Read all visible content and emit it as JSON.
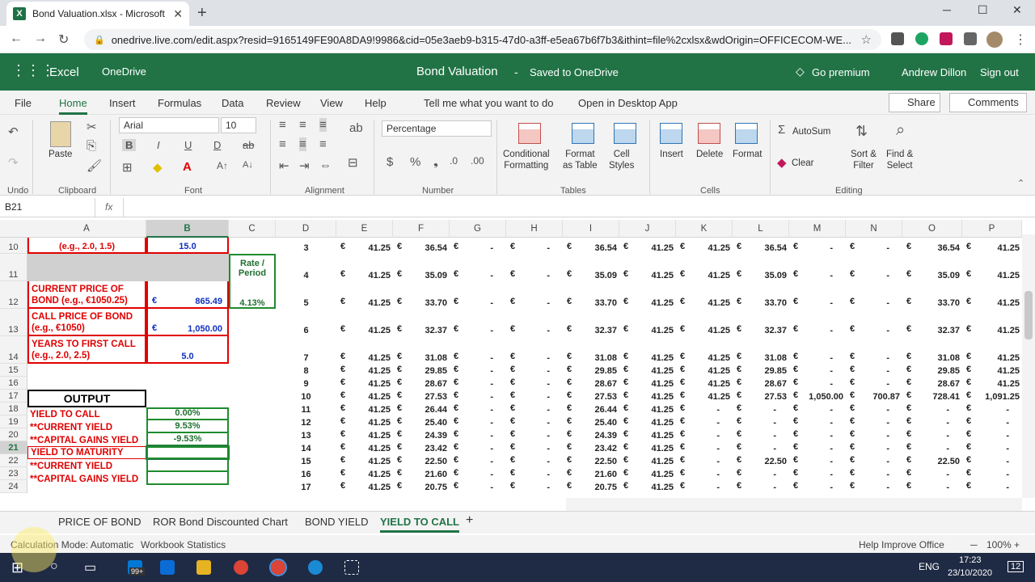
{
  "browser": {
    "tab_title": "Bond Valuation.xlsx - Microsoft E",
    "url": "onedrive.live.com/edit.aspx?resid=9165149FE90A8DA9!9986&cid=05e3aeb9-b315-47d0-a3ff-e5ea67b6f7b3&ithint=file%2cxlsx&wdOrigin=OFFICECOM-WE..."
  },
  "app": {
    "name": "Excel",
    "location": "OneDrive",
    "doc_title": "Bond Valuation",
    "dash": "-",
    "save_status": "Saved to OneDrive",
    "premium": "Go premium",
    "user": "Andrew Dillon",
    "signout": "Sign out"
  },
  "menu": {
    "items": [
      "File",
      "Home",
      "Insert",
      "Formulas",
      "Data",
      "Review",
      "View",
      "Help"
    ],
    "tell": "Tell me what you want to do",
    "open_desktop": "Open in Desktop App",
    "share": "Share",
    "comments": "Comments"
  },
  "ribbon": {
    "undo": "Undo",
    "clipboard": "Clipboard",
    "paste": "Paste",
    "font_name": "Arial",
    "font_size": "10",
    "font": "Font",
    "alignment": "Alignment",
    "number_format": "Percentage",
    "number": "Number",
    "cond_fmt": "Conditional\nFormatting",
    "fmt_table": "Format\nas Table",
    "cell_styles": "Cell\nStyles",
    "tables": "Tables",
    "insert": "Insert",
    "delete": "Delete",
    "format": "Format",
    "cells": "Cells",
    "autosum": "AutoSum",
    "clear": "Clear",
    "sort": "Sort &\nFilter",
    "find": "Find &\nSelect",
    "editing": "Editing",
    "bold": "B",
    "italic": "I",
    "underline": "U",
    "dunder": "D",
    "strike": "ab"
  },
  "formula_bar": {
    "name_box": "B21",
    "fx": "fx"
  },
  "columns": [
    "A",
    "B",
    "C",
    "D",
    "E",
    "F",
    "G",
    "H",
    "I",
    "J",
    "K",
    "L",
    "M",
    "N",
    "O",
    "P"
  ],
  "rows": [
    {
      "n": "10",
      "d": "3",
      "v": [
        "41.25",
        "36.54",
        "-",
        "-",
        "36.54",
        "41.25",
        "41.25",
        "36.54",
        "-",
        "-",
        "36.54",
        "41.25"
      ]
    },
    {
      "n": "11",
      "d": "4",
      "v": [
        "41.25",
        "35.09",
        "-",
        "-",
        "35.09",
        "41.25",
        "41.25",
        "35.09",
        "-",
        "-",
        "35.09",
        "41.25"
      ]
    },
    {
      "n": "12",
      "d": "5",
      "v": [
        "41.25",
        "33.70",
        "-",
        "-",
        "33.70",
        "41.25",
        "41.25",
        "33.70",
        "-",
        "-",
        "33.70",
        "41.25"
      ]
    },
    {
      "n": "13",
      "d": "6",
      "v": [
        "41.25",
        "32.37",
        "-",
        "-",
        "32.37",
        "41.25",
        "41.25",
        "32.37",
        "-",
        "-",
        "32.37",
        "41.25"
      ]
    },
    {
      "n": "14",
      "d": "7",
      "v": [
        "41.25",
        "31.08",
        "-",
        "-",
        "31.08",
        "41.25",
        "41.25",
        "31.08",
        "-",
        "-",
        "31.08",
        "41.25"
      ]
    },
    {
      "n": "15",
      "d": "8",
      "v": [
        "41.25",
        "29.85",
        "-",
        "-",
        "29.85",
        "41.25",
        "41.25",
        "29.85",
        "-",
        "-",
        "29.85",
        "41.25"
      ]
    },
    {
      "n": "16",
      "d": "9",
      "v": [
        "41.25",
        "28.67",
        "-",
        "-",
        "28.67",
        "41.25",
        "41.25",
        "28.67",
        "-",
        "-",
        "28.67",
        "41.25"
      ]
    },
    {
      "n": "17",
      "d": "10",
      "v": [
        "41.25",
        "27.53",
        "-",
        "-",
        "27.53",
        "41.25",
        "41.25",
        "27.53",
        "1,050.00",
        "700.87",
        "728.41",
        "1,091.25"
      ]
    },
    {
      "n": "18",
      "d": "11",
      "v": [
        "41.25",
        "26.44",
        "-",
        "-",
        "26.44",
        "41.25",
        "-",
        "-",
        "-",
        "-",
        "-",
        "-"
      ]
    },
    {
      "n": "19",
      "d": "12",
      "v": [
        "41.25",
        "25.40",
        "-",
        "-",
        "25.40",
        "41.25",
        "-",
        "-",
        "-",
        "-",
        "-",
        "-"
      ]
    },
    {
      "n": "20",
      "d": "13",
      "v": [
        "41.25",
        "24.39",
        "-",
        "-",
        "24.39",
        "41.25",
        "-",
        "-",
        "-",
        "-",
        "-",
        "-"
      ]
    },
    {
      "n": "21",
      "d": "14",
      "v": [
        "41.25",
        "23.42",
        "-",
        "-",
        "23.42",
        "41.25",
        "-",
        "-",
        "-",
        "-",
        "-",
        "-"
      ]
    },
    {
      "n": "22",
      "d": "15",
      "v": [
        "41.25",
        "22.50",
        "-",
        "-",
        "22.50",
        "41.25",
        "-",
        "22.50",
        "-",
        "-",
        "22.50",
        "-"
      ]
    },
    {
      "n": "23",
      "d": "16",
      "v": [
        "41.25",
        "21.60",
        "-",
        "-",
        "21.60",
        "41.25",
        "-",
        "-",
        "-",
        "-",
        "-",
        "-"
      ]
    },
    {
      "n": "24",
      "d": "17",
      "v": [
        "41.25",
        "20.75",
        "-",
        "-",
        "20.75",
        "41.25",
        "-",
        "-",
        "-",
        "-",
        "-",
        "-"
      ]
    }
  ],
  "cells": {
    "a10": "(e.g., 2.0, 1.5)",
    "b10": "15.0",
    "c11": "Rate /\nPeriod",
    "a12": "CURRENT PRICE OF\nBOND (e.g., €1050.25)",
    "b12_cur": "€",
    "b12": "865.49",
    "c12": "4.13%",
    "a13": "CALL PRICE OF BOND\n(e.g., €1050)",
    "b13_cur": "€",
    "b13": "1,050.00",
    "a14": "YEARS TO FIRST CALL\n(e.g., 2.0, 2.5)",
    "b14": "5.0",
    "a17": "OUTPUT",
    "a18": "YIELD TO CALL",
    "b18": "0.00%",
    "a19": "**CURRENT YIELD",
    "b19": "9.53%",
    "a20": "**CAPITAL GAINS YIELD",
    "b20": "-9.53%",
    "a21": "YIELD TO MATURITY",
    "a22": "**CURRENT YIELD",
    "a23": "**CAPITAL GAINS YIELD",
    "euro": "€"
  },
  "sheets": [
    "PRICE OF BOND",
    "ROR Bond Discounted Chart",
    "BOND YIELD",
    "YIELD TO CALL"
  ],
  "add_sheet": "+",
  "status": {
    "calc": "Calculation Mode: Automatic",
    "stats": "Workbook Statistics",
    "help": "Help Improve Office",
    "zoom": "100%"
  },
  "taskbar": {
    "badge": "99+",
    "lang": "ENG",
    "time": "17:23",
    "date": "23/10/2020",
    "notif": "12"
  }
}
